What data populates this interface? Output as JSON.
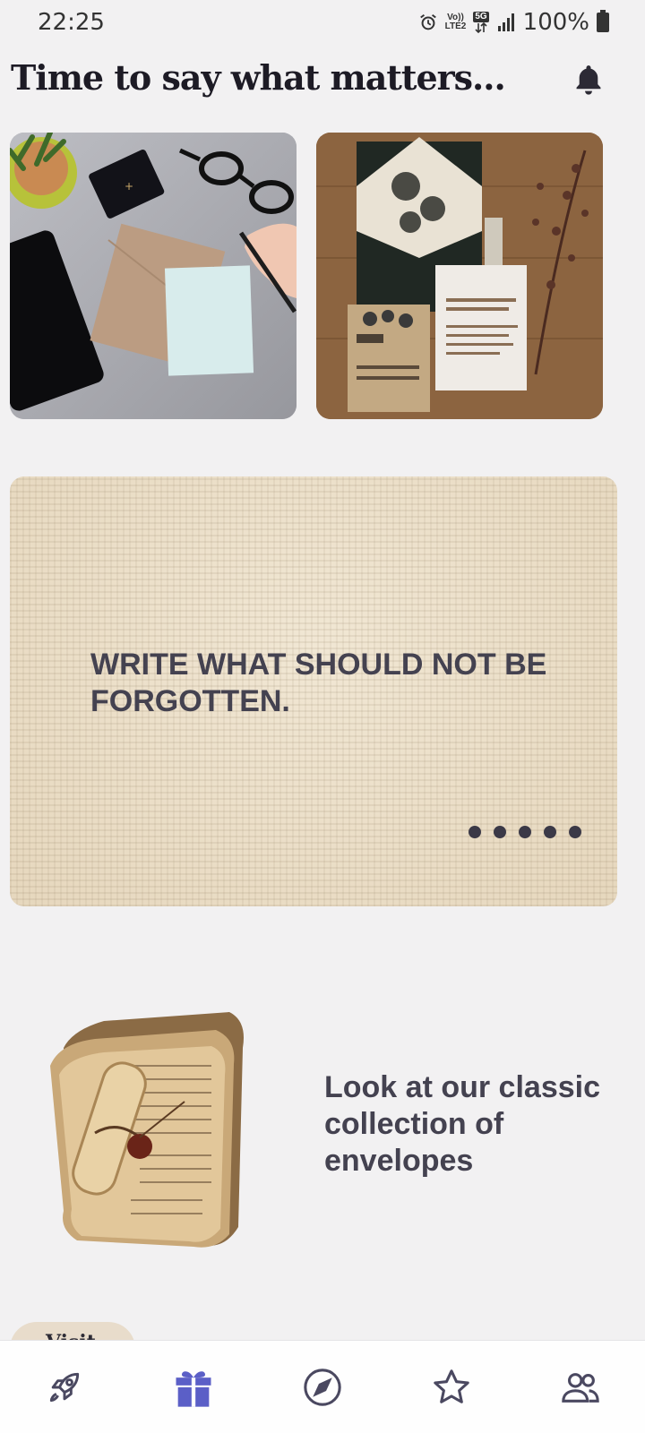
{
  "status_bar": {
    "time": "22:25",
    "network_top": "Vo))",
    "network_bottom": "LTE2",
    "network_5g": "5G",
    "battery": "100%"
  },
  "header": {
    "title": "Time to say what matters..."
  },
  "banner": {
    "text": "WRITE WHAT SHOULD NOT BE FORGOTTEN.",
    "dots_count": 5
  },
  "collection": {
    "text": "Look at our classic collection of envelopes"
  },
  "visit_button": {
    "label": "Visit"
  },
  "bottom_nav": {
    "items": [
      "rocket-icon",
      "gift-icon",
      "compass-icon",
      "star-icon",
      "people-icon"
    ],
    "active": "gift-icon",
    "active_color": "#5b5fc7",
    "inactive_color": "#4a4860"
  }
}
